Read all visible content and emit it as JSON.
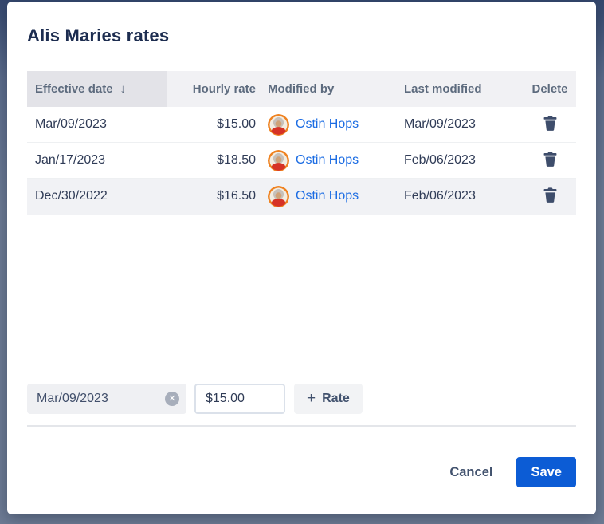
{
  "modal": {
    "title": "Alis Maries rates",
    "table": {
      "headers": {
        "effective_date": "Effective date",
        "hourly_rate": "Hourly rate",
        "modified_by": "Modified by",
        "last_modified": "Last modified",
        "delete": "Delete"
      },
      "sort": {
        "column": "effective_date",
        "direction": "desc",
        "icon": "↓"
      },
      "rows": [
        {
          "effective_date": "Mar/09/2023",
          "hourly_rate": "$15.00",
          "modified_by": "Ostin Hops",
          "last_modified": "Mar/09/2023",
          "highlighted": false
        },
        {
          "effective_date": "Jan/17/2023",
          "hourly_rate": "$18.50",
          "modified_by": "Ostin Hops",
          "last_modified": "Feb/06/2023",
          "highlighted": false
        },
        {
          "effective_date": "Dec/30/2022",
          "hourly_rate": "$16.50",
          "modified_by": "Ostin Hops",
          "last_modified": "Feb/06/2023",
          "highlighted": true
        }
      ]
    },
    "form": {
      "date_value": "Mar/09/2023",
      "clear_icon": "✕",
      "rate_value": "$15.00",
      "plus_icon": "+",
      "add_rate_label": "Rate"
    },
    "footer": {
      "cancel_label": "Cancel",
      "save_label": "Save"
    }
  },
  "icons": {
    "trash": "trash-delete",
    "avatar": "ostin-hops-avatar",
    "sort_desc": "↓",
    "clear": "✕"
  },
  "colors": {
    "backdrop": "#6d7b94",
    "title_text": "#1d2d50",
    "header_bg": "#f1f1f4",
    "sorted_header_bg": "#e3e3e8",
    "header_text": "#5d6b7e",
    "row_text": "#303c57",
    "highlighted_row_bg": "#f1f2f5",
    "link_blue": "#1b6ce3",
    "trash_icon": "#3e4d6b",
    "save_button_bg": "#0c5cd5",
    "avatar_ring": "#ef8220"
  }
}
